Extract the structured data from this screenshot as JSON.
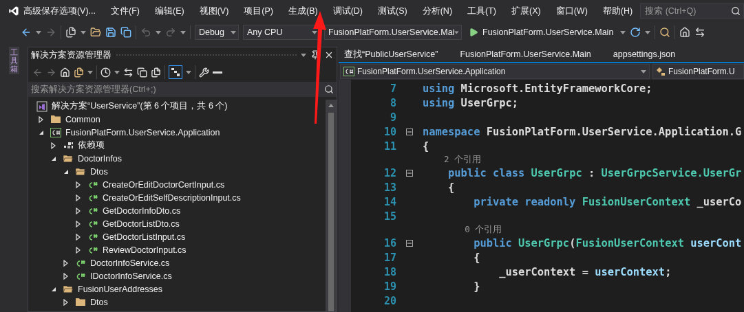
{
  "menu_bar": {
    "solution_title": "高级保存选项(V)...",
    "items": [
      "文件(F)",
      "编辑(E)",
      "视图(V)",
      "项目(P)",
      "生成(B)",
      "调试(D)",
      "测试(S)",
      "分析(N)",
      "工具(T)",
      "扩展(X)",
      "窗口(W)",
      "帮助(H)"
    ],
    "search": {
      "placeholder": "搜索 (Ctrl+Q)"
    }
  },
  "toolbar": {
    "configuration": "Debug",
    "platform": "Any CPU",
    "startup_project": "FusionPlatForm.UserService.Mai",
    "run_target": "FusionPlatForm.UserService.Main"
  },
  "side_tab": "工具箱",
  "solution_explorer": {
    "title": "解决方案资源管理器",
    "search": {
      "placeholder": "搜索解决方案资源管理器(Ctrl+;)"
    },
    "tree": {
      "kind": "solution",
      "label": "解决方案“UserService”(第 6 个项目，共 6 个)",
      "children": [
        {
          "kind": "folder",
          "label": "Common",
          "expanded": false
        },
        {
          "kind": "project",
          "label": "FusionPlatForm.UserService.Application",
          "expanded": true,
          "children": [
            {
              "kind": "dependencies",
              "label": "依赖项",
              "expanded": false
            },
            {
              "kind": "folder",
              "label": "DoctorInfos",
              "expanded": true,
              "children": [
                {
                  "kind": "folder",
                  "label": "Dtos",
                  "expanded": true,
                  "children": [
                    {
                      "kind": "csfile",
                      "label": "CreateOrEditDoctorCertInput.cs",
                      "expanded": false
                    },
                    {
                      "kind": "csfile",
                      "label": "CreateOrEditSelfDescriptionInput.cs",
                      "expanded": false
                    },
                    {
                      "kind": "csfile",
                      "label": "GetDoctorInfoDto.cs",
                      "expanded": false
                    },
                    {
                      "kind": "csfile",
                      "label": "GetDoctorListDto.cs",
                      "expanded": false
                    },
                    {
                      "kind": "csfile",
                      "label": "GetDoctorListInput.cs",
                      "expanded": false
                    },
                    {
                      "kind": "csfile",
                      "label": "ReviewDoctorInput.cs",
                      "expanded": false
                    }
                  ]
                },
                {
                  "kind": "csfile",
                  "label": "DoctorInfoService.cs",
                  "expanded": false
                },
                {
                  "kind": "csfile",
                  "label": "IDoctorInfoService.cs",
                  "expanded": false
                }
              ]
            },
            {
              "kind": "folder",
              "label": "FusionUserAddresses",
              "expanded": true,
              "children": [
                {
                  "kind": "folder",
                  "label": "Dtos",
                  "expanded": false
                }
              ]
            }
          ]
        }
      ]
    }
  },
  "editor": {
    "tabs": [
      {
        "label": "查找“PublicUserService”",
        "selected": false
      },
      {
        "label": "FusionPlatForm.UserService.Main",
        "selected": false
      },
      {
        "label": "appsettings.json",
        "selected": false
      }
    ],
    "nav_project": "FusionPlatForm.UserService.Application",
    "nav_type": "FusionPlatForm.U",
    "lines": [
      {
        "kind": "code",
        "number": "7",
        "fold": false,
        "tokens": [
          {
            "kind": "keyword",
            "text": "using"
          },
          {
            "kind": "plain",
            "text": " Microsoft.EntityFrameworkCore;"
          }
        ]
      },
      {
        "kind": "code",
        "number": "8",
        "fold": false,
        "tokens": [
          {
            "kind": "keyword",
            "text": "using"
          },
          {
            "kind": "plain",
            "text": " UserGrpc;"
          }
        ]
      },
      {
        "kind": "code",
        "number": "9",
        "fold": false
      },
      {
        "kind": "code",
        "number": "10",
        "fold": true,
        "tokens": [
          {
            "kind": "keyword",
            "text": "namespace"
          },
          {
            "kind": "plain",
            "text": " FusionPlatForm.UserService.Application.G"
          }
        ]
      },
      {
        "kind": "code",
        "number": "11",
        "fold": false,
        "tokens": [
          {
            "kind": "plain",
            "text": "{"
          }
        ]
      },
      {
        "kind": "lens",
        "text": "    2 个引用"
      },
      {
        "kind": "code",
        "number": "12",
        "fold": true,
        "tokens": [
          {
            "kind": "keyword",
            "text": "    public class"
          },
          {
            "kind": "type",
            "text": " UserGrpc"
          },
          {
            "kind": "plain",
            "text": " : "
          },
          {
            "kind": "type",
            "text": "UserGrpcService.UserGr"
          }
        ]
      },
      {
        "kind": "code",
        "number": "13",
        "fold": false,
        "tokens": [
          {
            "kind": "plain",
            "text": "    {"
          }
        ]
      },
      {
        "kind": "code",
        "number": "14",
        "fold": false,
        "tokens": [
          {
            "kind": "keyword",
            "text": "        private readonly"
          },
          {
            "kind": "type",
            "text": " FusionUserContext"
          },
          {
            "kind": "plain",
            "text": " _userCo"
          }
        ]
      },
      {
        "kind": "code",
        "number": "15",
        "fold": false
      },
      {
        "kind": "lens",
        "text": "        0 个引用"
      },
      {
        "kind": "code",
        "number": "16",
        "fold": true,
        "tokens": [
          {
            "kind": "keyword",
            "text": "        public"
          },
          {
            "kind": "type",
            "text": " UserGrpc"
          },
          {
            "kind": "plain",
            "text": "("
          },
          {
            "kind": "type",
            "text": "FusionUserContext"
          },
          {
            "kind": "param",
            "text": " userCont"
          }
        ]
      },
      {
        "kind": "code",
        "number": "17",
        "fold": false,
        "tokens": [
          {
            "kind": "plain",
            "text": "        {"
          }
        ]
      },
      {
        "kind": "code",
        "number": "18",
        "fold": false,
        "tokens": [
          {
            "kind": "plain",
            "text": "            _userContext = "
          },
          {
            "kind": "param",
            "text": "userContext"
          },
          {
            "kind": "plain",
            "text": ";"
          }
        ]
      },
      {
        "kind": "code",
        "number": "19",
        "fold": false,
        "tokens": [
          {
            "kind": "plain",
            "text": "        }"
          }
        ]
      },
      {
        "kind": "code",
        "number": "20",
        "fold": false
      }
    ]
  }
}
